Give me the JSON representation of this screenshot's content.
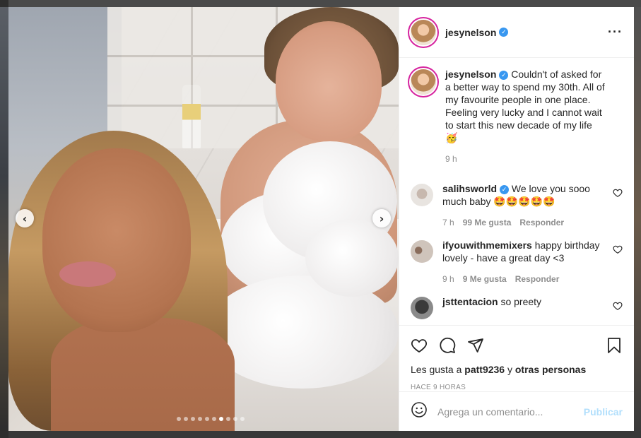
{
  "post": {
    "username": "jesynelson",
    "caption": "Couldn't of asked for a better way to spend my 30th. All of my favourite people in one place. Feeling very lucky and I cannot wait to start this new decade of my life 🥳",
    "caption_time": "9 h"
  },
  "comments": [
    {
      "username": "salihsworld",
      "verified": true,
      "text": "We love you sooo much baby 🤩🤩🤩🤩🤩",
      "time": "7 h",
      "likes": "99 Me gusta",
      "reply": "Responder"
    },
    {
      "username": "ifyouwithmemixers",
      "verified": false,
      "text": "happy birthday lovely - have a great day <3",
      "time": "9 h",
      "likes": "9 Me gusta",
      "reply": "Responder"
    },
    {
      "username": "jsttentacion",
      "verified": false,
      "text": "so preety",
      "time": "",
      "likes": "",
      "reply": ""
    }
  ],
  "actions": {
    "liked_by_prefix": "Les gusta a",
    "liked_by_user": "patt9236",
    "liked_by_suffix_joiner": "y",
    "liked_by_others": "otras personas",
    "timestamp": "HACE 9 HORAS"
  },
  "add_comment": {
    "placeholder": "Agrega un comentario...",
    "post_label": "Publicar"
  },
  "carousel": {
    "slide_count": 10,
    "active_index": 6
  },
  "icons": {
    "prev": "chevron-left-icon",
    "next": "chevron-right-icon",
    "more": "more-options-icon",
    "like": "heart-icon",
    "comment": "comment-icon",
    "share": "share-icon",
    "save": "bookmark-icon",
    "emoji": "emoji-icon"
  },
  "colors": {
    "accent": "#3897f0",
    "post_button_disabled": "#b2dffc",
    "meta_text": "#8e8e8e"
  }
}
